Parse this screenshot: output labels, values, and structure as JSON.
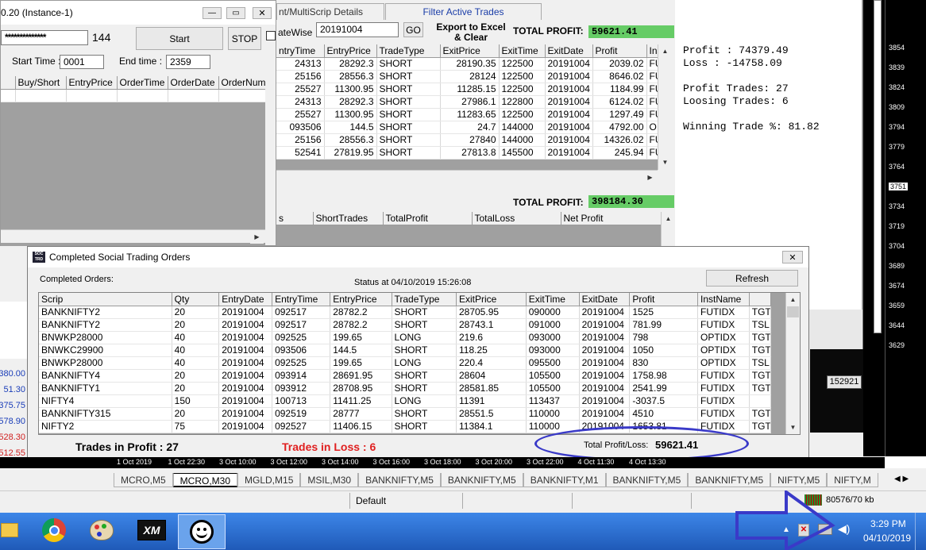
{
  "mt_window": {
    "title": "0.20   (Instance-1)",
    "password_mask": "**************",
    "instance_count": "144",
    "start_label": "Start",
    "stop_label": "STOP",
    "start_time_label": "Start Time :",
    "start_time_value": "0001",
    "end_time_label": "End time :",
    "end_time_value": "2359",
    "columns": [
      "Buy/Short",
      "EntryPrice",
      "OrderTime",
      "OrderDate",
      "OrderNumb"
    ]
  },
  "left_price_strip": [
    "380.00",
    "51.30",
    "375.75",
    "578.90",
    "528.30",
    "512.55"
  ],
  "trades_panel": {
    "tab_multiscrip": "nt/MultiScrip Details",
    "tab_filter": "Filter Active Trades",
    "datewise_label": "ateWise",
    "date_value": "20191004",
    "go_label": "GO",
    "export_label": "Export to Excel & Clear",
    "total_profit_label": "TOTAL PROFIT:",
    "total_profit_value": "59621.41",
    "columns": [
      "ntryTime",
      "EntryPrice",
      "TradeType",
      "ExitPrice",
      "ExitTime",
      "ExitDate",
      "Profit",
      "Ins"
    ],
    "rows": [
      [
        "24313",
        "28292.3",
        "SHORT",
        "28190.35",
        "122500",
        "20191004",
        "2039.02",
        "FU"
      ],
      [
        "25156",
        "28556.3",
        "SHORT",
        "28124",
        "122500",
        "20191004",
        "8646.02",
        "FU"
      ],
      [
        "25527",
        "11300.95",
        "SHORT",
        "11285.15",
        "122500",
        "20191004",
        "1184.99",
        "FU"
      ],
      [
        "24313",
        "28292.3",
        "SHORT",
        "27986.1",
        "122800",
        "20191004",
        "6124.02",
        "FU"
      ],
      [
        "25527",
        "11300.95",
        "SHORT",
        "11283.65",
        "122500",
        "20191004",
        "1297.49",
        "FU"
      ],
      [
        "093506",
        "144.5",
        "SHORT",
        "24.7",
        "144000",
        "20191004",
        "4792.00",
        "O"
      ],
      [
        "25156",
        "28556.3",
        "SHORT",
        "27840",
        "144000",
        "20191004",
        "14326.02",
        "FU"
      ],
      [
        "52541",
        "27819.95",
        "SHORT",
        "27813.8",
        "145500",
        "20191004",
        "245.94",
        "FU"
      ]
    ],
    "total_profit2_label": "TOTAL PROFIT:",
    "total_profit2_value": "398184.30",
    "summary_columns": [
      "s",
      "ShortTrades",
      "TotalProfit",
      "TotalLoss",
      "Net Profit"
    ]
  },
  "stats": {
    "profit": "Profit : 74379.49",
    "loss": "Loss : -14758.09",
    "profit_trades": "Profit Trades: 27",
    "loosing_trades": "Loosing Trades: 6",
    "winning_pct": "Winning Trade %: 81.82"
  },
  "price_axis": [
    "3854",
    "3839",
    "3824",
    "3809",
    "3794",
    "3779",
    "3764",
    "3751",
    "3734",
    "3719",
    "3704",
    "3689",
    "3674",
    "3659",
    "3644",
    "3629"
  ],
  "chart_label_152921": "152921",
  "dialog": {
    "title": "Completed Social Trading Orders",
    "completed_label": "Completed Orders:",
    "status": "Status at 04/10/2019 15:26:08",
    "refresh_label": "Refresh",
    "columns": [
      "Scrip",
      "Qty",
      "EntryDate",
      "EntryTime",
      "EntryPrice",
      "TradeType",
      "ExitPrice",
      "ExitTime",
      "ExitDate",
      "Profit",
      "InstName",
      ""
    ],
    "rows": [
      [
        "BANKNIFTY2",
        "20",
        "20191004",
        "092517",
        "28782.2",
        "SHORT",
        "28705.95",
        "090000",
        "20191004",
        "1525",
        "FUTIDX",
        "TGT1"
      ],
      [
        "BANKNIFTY2",
        "20",
        "20191004",
        "092517",
        "28782.2",
        "SHORT",
        "28743.1",
        "091000",
        "20191004",
        "781.99",
        "FUTIDX",
        "TSL"
      ],
      [
        "BNWKP28000",
        "40",
        "20191004",
        "092525",
        "199.65",
        "LONG",
        "219.6",
        "093000",
        "20191004",
        "798",
        "OPTIDX",
        "TGT1"
      ],
      [
        "BNWKC29900",
        "40",
        "20191004",
        "093506",
        "144.5",
        "SHORT",
        "118.25",
        "093000",
        "20191004",
        "1050",
        "OPTIDX",
        "TGT1"
      ],
      [
        "BNWKP28000",
        "40",
        "20191004",
        "092525",
        "199.65",
        "LONG",
        "220.4",
        "095500",
        "20191004",
        "830",
        "OPTIDX",
        "TSL"
      ],
      [
        "BANKNIFTY4",
        "20",
        "20191004",
        "093914",
        "28691.95",
        "SHORT",
        "28604",
        "105500",
        "20191004",
        "1758.98",
        "FUTIDX",
        "TGT1"
      ],
      [
        "BANKNIFTY1",
        "20",
        "20191004",
        "093912",
        "28708.95",
        "SHORT",
        "28581.85",
        "105500",
        "20191004",
        "2541.99",
        "FUTIDX",
        "TGT1"
      ],
      [
        "NIFTY4",
        "150",
        "20191004",
        "100713",
        "11411.25",
        "LONG",
        "11391",
        "113437",
        "20191004",
        "-3037.5",
        "FUTIDX",
        ""
      ],
      [
        "BANKNIFTY315",
        "20",
        "20191004",
        "092519",
        "28777",
        "SHORT",
        "28551.5",
        "110000",
        "20191004",
        "4510",
        "FUTIDX",
        "TGT1"
      ],
      [
        "NIFTY2",
        "75",
        "20191004",
        "092527",
        "11406.15",
        "SHORT",
        "11384.1",
        "110000",
        "20191004",
        "1653.81",
        "FUTIDX",
        "TGT1"
      ]
    ],
    "trades_in_profit": "Trades in Profit : 27",
    "trades_in_loss": "Trades in Loss : 6",
    "total_pl_label": "Total Profit/Loss:",
    "total_pl_value": "59621.41"
  },
  "time_axis": [
    "1 Oct 2019",
    "1 Oct 22:30",
    "3 Oct 10:00",
    "3 Oct 12:00",
    "3 Oct 14:00",
    "3 Oct 16:00",
    "3 Oct 18:00",
    "3 Oct 20:00",
    "3 Oct 22:00",
    "4 Oct 11:30",
    "4 Oct 13:30"
  ],
  "chart_tabs": [
    "MCRO,M5",
    "MCRO,M30",
    "MGLD,M15",
    "MSIL,M30",
    "BANKNIFTY,M5",
    "BANKNIFTY,M5",
    "BANKNIFTY,M1",
    "BANKNIFTY,M5",
    "BANKNIFTY,M5",
    "NIFTY,M5",
    "NIFTY,M"
  ],
  "status_bar": {
    "profile": "Default",
    "traffic": "80576/70 kb"
  },
  "taskbar": {
    "time": "3:29 PM",
    "date": "04/10/2019",
    "xm_label": "XM"
  },
  "colors": {
    "accent_green": "#66cc66",
    "loss_red": "#e02020",
    "annotation_blue": "#3a3ac8",
    "taskbar_blue": "#2a6fd0"
  }
}
